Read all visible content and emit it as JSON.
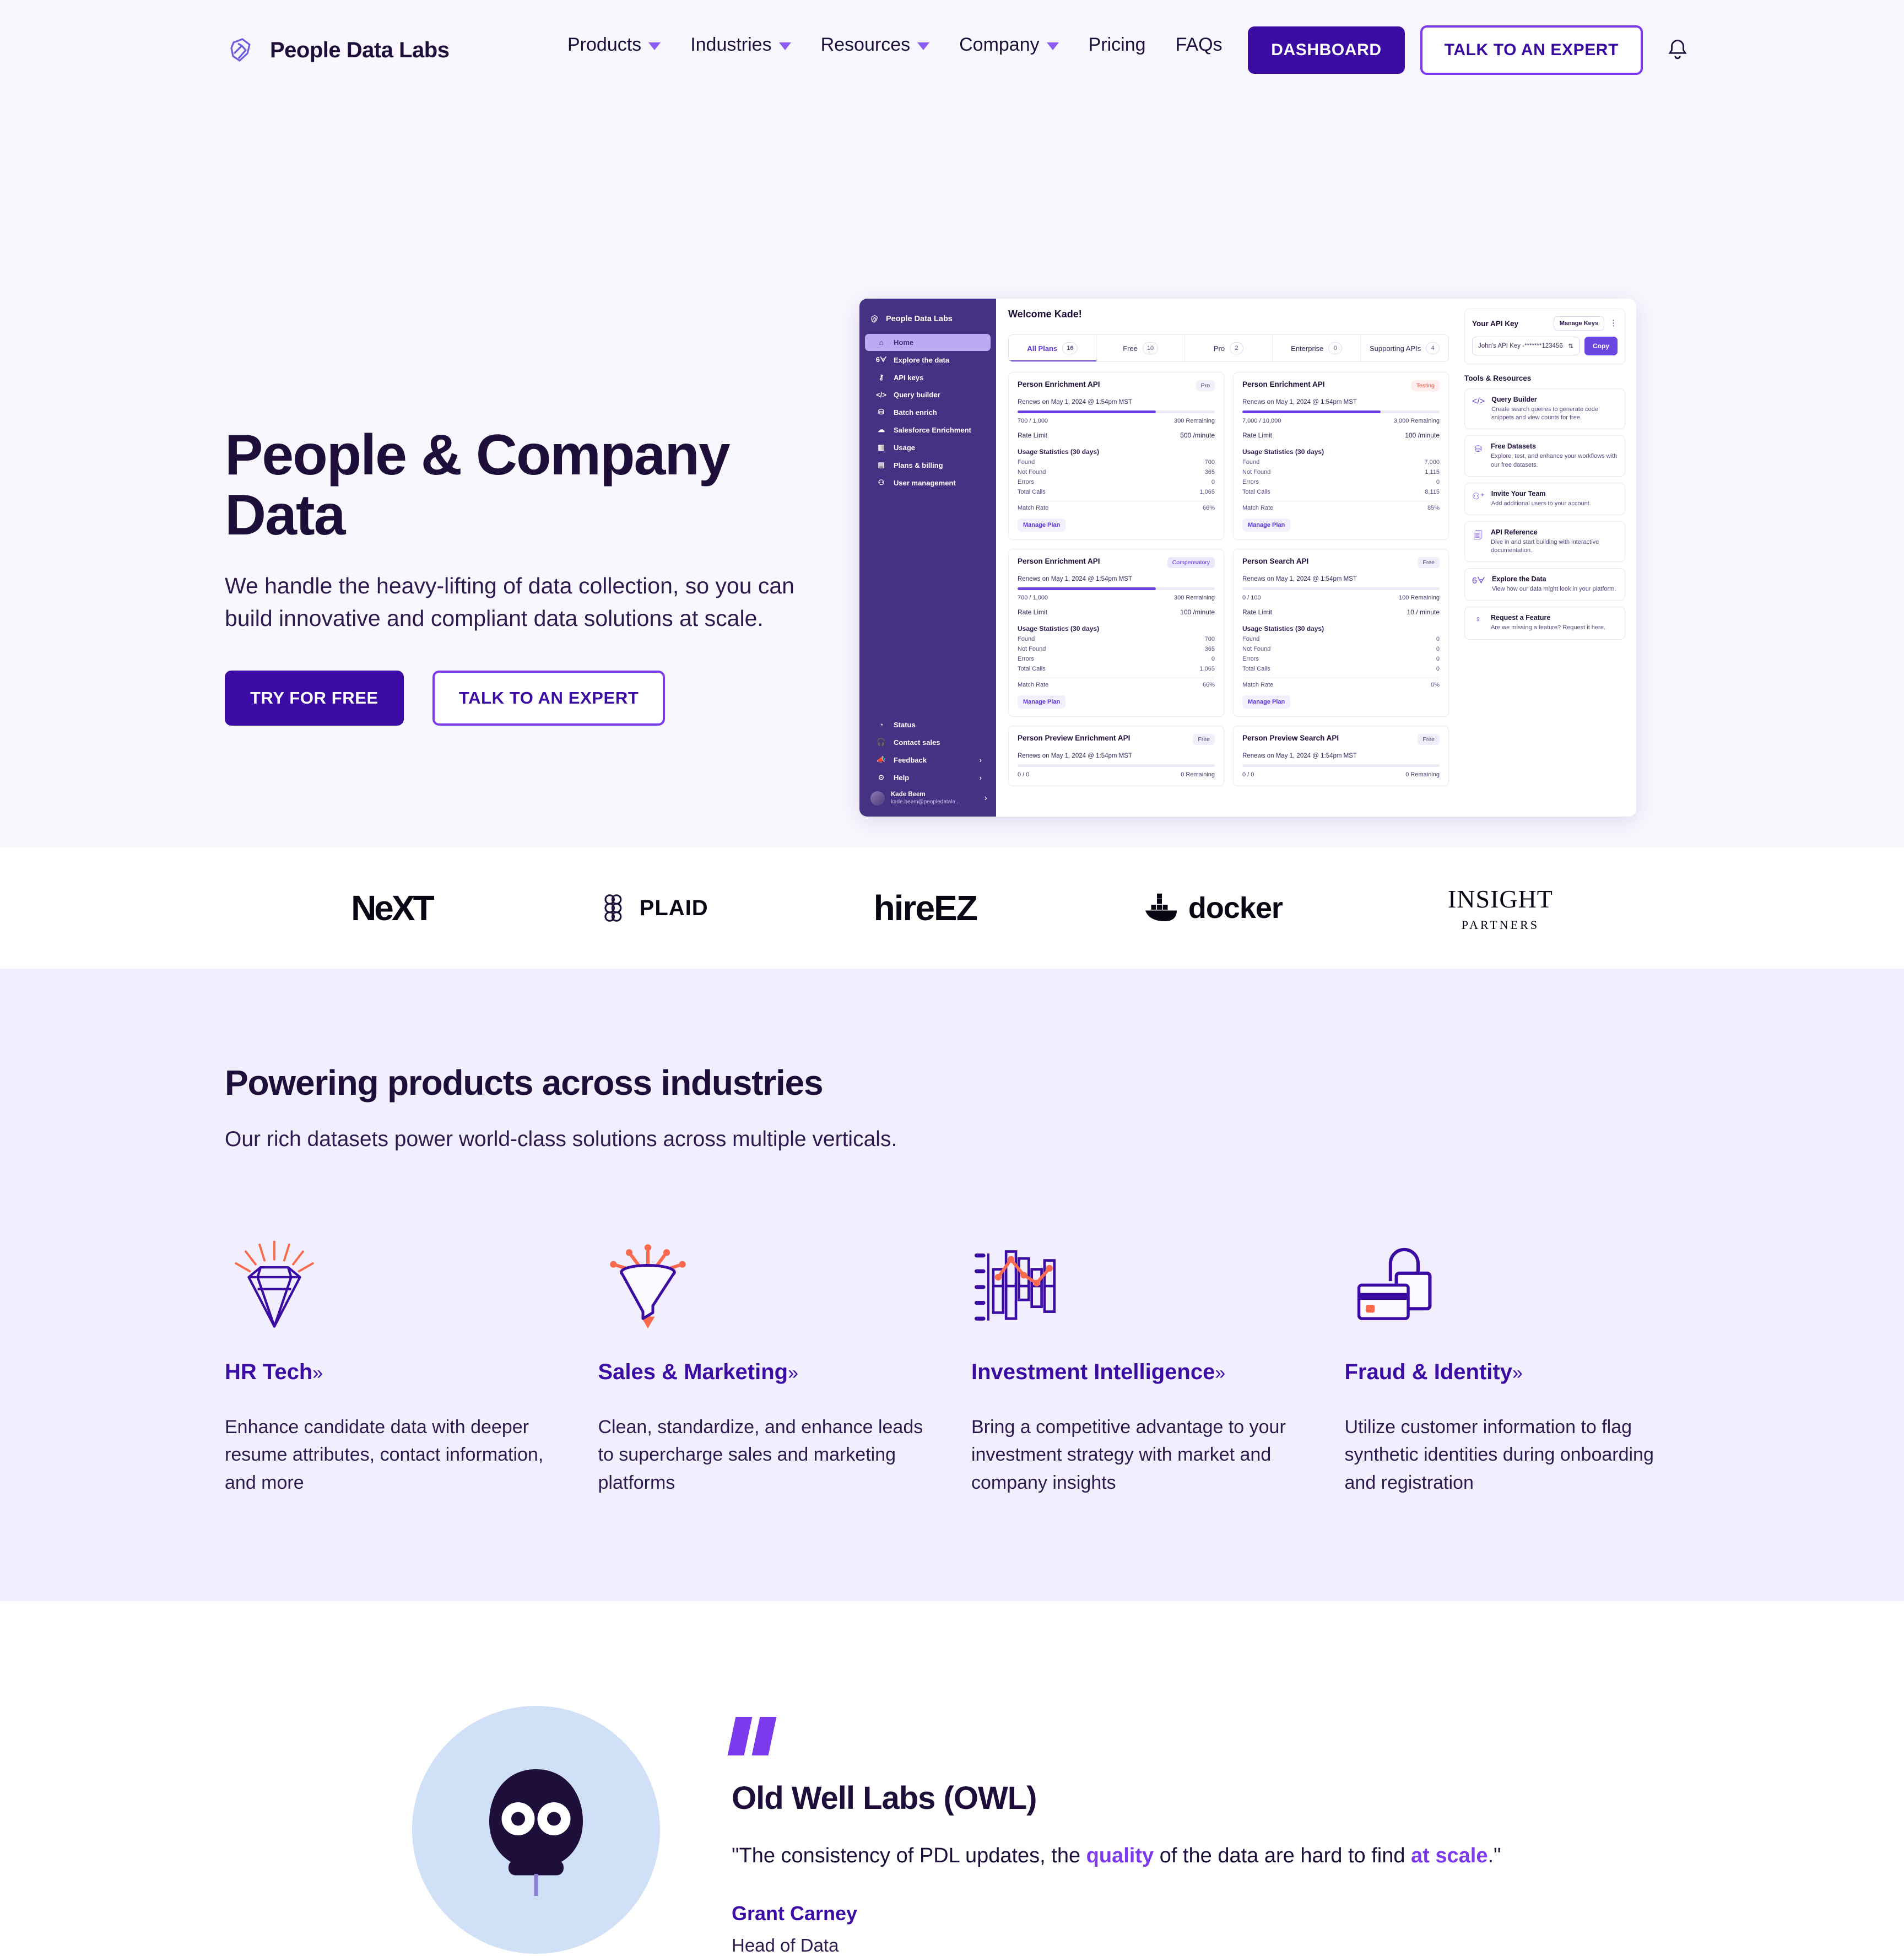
{
  "header": {
    "brand": "People Data Labs",
    "nav": [
      {
        "label": "Products",
        "caret": true
      },
      {
        "label": "Industries",
        "caret": true
      },
      {
        "label": "Resources",
        "caret": true
      },
      {
        "label": "Company",
        "caret": true
      },
      {
        "label": "Pricing",
        "caret": false
      },
      {
        "label": "FAQs",
        "caret": false
      }
    ],
    "dashboard_label": "DASHBOARD",
    "expert_label": "TALK TO AN EXPERT",
    "bell_icon": "bell-icon"
  },
  "hero": {
    "title": "People & Company Data",
    "subtitle": "We handle the heavy-lifting of data collection, so you can build innovative and compliant data solutions at scale.",
    "cta_primary": "TRY FOR FREE",
    "cta_secondary": "TALK TO AN EXPERT"
  },
  "dashboard": {
    "sidebar": {
      "brand": "People Data Labs",
      "collapse_icon": "chevron-left-icon",
      "items": [
        {
          "label": "Home",
          "icon": "home-icon",
          "active": true
        },
        {
          "label": "Explore the data",
          "icon": "glasses-icon",
          "active": false
        },
        {
          "label": "API keys",
          "icon": "key-icon",
          "active": false
        },
        {
          "label": "Query builder",
          "icon": "code-icon",
          "active": false
        },
        {
          "label": "Batch enrich",
          "icon": "database-icon",
          "active": false
        },
        {
          "label": "Salesforce Enrichment",
          "icon": "cloud-icon",
          "active": false
        },
        {
          "label": "Usage",
          "icon": "bar-chart-icon",
          "active": false
        },
        {
          "label": "Plans & billing",
          "icon": "document-icon",
          "active": false
        },
        {
          "label": "User management",
          "icon": "user-icon",
          "active": false
        }
      ],
      "bottom_items": [
        {
          "label": "Status",
          "icon": "status-icon",
          "chevron": false
        },
        {
          "label": "Contact sales",
          "icon": "headset-icon",
          "chevron": false
        },
        {
          "label": "Feedback",
          "icon": "megaphone-icon",
          "chevron": true
        },
        {
          "label": "Help",
          "icon": "question-icon",
          "chevron": true
        }
      ],
      "user": {
        "name": "Kade Beem",
        "email": "kade.beem@peopledatala...",
        "chevron": "chevron-right-icon"
      }
    },
    "welcome": "Welcome Kade!",
    "tabs": [
      {
        "label": "All Plans",
        "count": "16",
        "active": true
      },
      {
        "label": "Free",
        "count": "10",
        "active": false
      },
      {
        "label": "Pro",
        "count": "2",
        "active": false
      },
      {
        "label": "Enterprise",
        "count": "0",
        "active": false
      },
      {
        "label": "Supporting APIs",
        "count": "4",
        "active": false
      }
    ],
    "stat_labels": {
      "renews_prefix": "Renews on",
      "rate_limit": "Rate Limit",
      "usage_header": "Usage Statistics (30 days)",
      "found": "Found",
      "not_found": "Not Found",
      "errors": "Errors",
      "total_calls": "Total Calls",
      "match_rate": "Match Rate",
      "manage_plan": "Manage Plan"
    },
    "cards": [
      {
        "title": "Person Enrichment API",
        "pill": "Pro",
        "pill_type": "default",
        "renews": "Renews on May 1, 2024 @ 1:54pm MST",
        "progress": 70,
        "usage": "700 / 1,000",
        "remaining": "300 Remaining",
        "rate_limit": "500 /minute",
        "found": "700",
        "not_found": "365",
        "errors": "0",
        "total_calls": "1,065",
        "match_rate": "66%",
        "full": true
      },
      {
        "title": "Person Enrichment API",
        "pill": "Testing",
        "pill_type": "testing",
        "renews": "Renews on May 1, 2024 @ 1:54pm MST",
        "progress": 70,
        "usage": "7,000 / 10,000",
        "remaining": "3,000 Remaining",
        "rate_limit": "100 /minute",
        "found": "7,000",
        "not_found": "1,115",
        "errors": "0",
        "total_calls": "8,115",
        "match_rate": "85%",
        "full": true
      },
      {
        "title": "Person Enrichment API",
        "pill": "Compensatory",
        "pill_type": "comp",
        "renews": "Renews on May 1, 2024 @ 1:54pm MST",
        "progress": 70,
        "usage": "700 / 1,000",
        "remaining": "300 Remaining",
        "rate_limit": "100 /minute",
        "found": "700",
        "not_found": "365",
        "errors": "0",
        "total_calls": "1,065",
        "match_rate": "66%",
        "full": true
      },
      {
        "title": "Person Search API",
        "pill": "Free",
        "pill_type": "default",
        "renews": "Renews on May 1, 2024 @ 1:54pm MST",
        "progress": 0,
        "usage": "0 / 100",
        "remaining": "100 Remaining",
        "rate_limit": "10 / minute",
        "found": "0",
        "not_found": "0",
        "errors": "0",
        "total_calls": "0",
        "match_rate": "0%",
        "full": true
      },
      {
        "title": "Person Preview Enrichment API",
        "pill": "Free",
        "pill_type": "default",
        "renews": "Renews on May 1, 2024 @ 1:54pm MST",
        "progress": 0,
        "usage": "0 / 0",
        "remaining": "0 Remaining",
        "full": false
      },
      {
        "title": "Person Preview Search API",
        "pill": "Free",
        "pill_type": "default",
        "renews": "Renews on May 1, 2024 @ 1:54pm MST",
        "progress": 0,
        "usage": "0 / 0",
        "remaining": "0 Remaining",
        "full": false
      }
    ],
    "api_key": {
      "title": "Your API Key",
      "manage_label": "Manage Keys",
      "kebab_icon": "kebab-menu-icon",
      "value": "John's API Key -*******123456",
      "copy_label": "Copy"
    },
    "tools_title": "Tools & Resources",
    "tools": [
      {
        "name": "Query Builder",
        "icon": "code-icon",
        "desc": "Create search queries to generate code snippets and view counts for free."
      },
      {
        "name": "Free Datasets",
        "icon": "database-icon",
        "desc": "Explore, test, and enhance your workflows with our free datasets."
      },
      {
        "name": "Invite Your Team",
        "icon": "user-plus-icon",
        "desc": "Add additional users to your account."
      },
      {
        "name": "API Reference",
        "icon": "document-search-icon",
        "desc": "Dive in and start building with interactive documentation."
      },
      {
        "name": "Explore the Data",
        "icon": "glasses-icon",
        "desc": "View how our data might look in your platform."
      },
      {
        "name": "Request a Feature",
        "icon": "lightbulb-icon",
        "desc": "Are we missing a feature? Request it here."
      }
    ]
  },
  "logos": [
    {
      "name": "NeXT",
      "icon": "next-logo"
    },
    {
      "name": "PLAID",
      "icon": "plaid-logo"
    },
    {
      "name": "hireEZ",
      "icon": "hireez-logo"
    },
    {
      "name": "docker",
      "icon": "docker-logo"
    },
    {
      "name": "INSIGHT PARTNERS",
      "icon": "insight-partners-logo"
    }
  ],
  "industries": {
    "title": "Powering products across industries",
    "subtitle": "Our rich datasets power world-class solutions across multiple verticals.",
    "chev": "»",
    "cards": [
      {
        "title": "HR Tech",
        "icon": "diamond-icon",
        "desc": "Enhance candidate data with deeper resume attributes, contact information, and more"
      },
      {
        "title": "Sales & Marketing",
        "icon": "funnel-icon",
        "desc": "Clean, standardize, and enhance leads to supercharge sales and marketing platforms"
      },
      {
        "title": "Investment Intelligence",
        "icon": "chart-icon",
        "desc": "Bring a competitive advantage to your investment strategy with market and company insights"
      },
      {
        "title": "Fraud & Identity",
        "icon": "lock-card-icon",
        "desc": "Utilize customer information to flag synthetic identities during onboarding and registration"
      }
    ]
  },
  "testimonial": {
    "avatar_icon": "owl-avatar",
    "quote_icon": "quote-mark-icon",
    "company": "Old Well Labs (OWL)",
    "quote_part1": "\"The consistency of PDL updates, the ",
    "quote_hl1": "quality",
    "quote_part2": " of the data are hard to find ",
    "quote_hl2": "at scale",
    "quote_part3": ".\"",
    "author": "Grant Carney",
    "role": "Head of Data"
  },
  "colors": {
    "brand_purple": "#3b0ca3",
    "accent_violet": "#7c3aed",
    "ink": "#1d0f3a",
    "hero_bg": "#f8f7fe",
    "industries_bg": "#f1effd",
    "coral": "#fa6a4f"
  }
}
